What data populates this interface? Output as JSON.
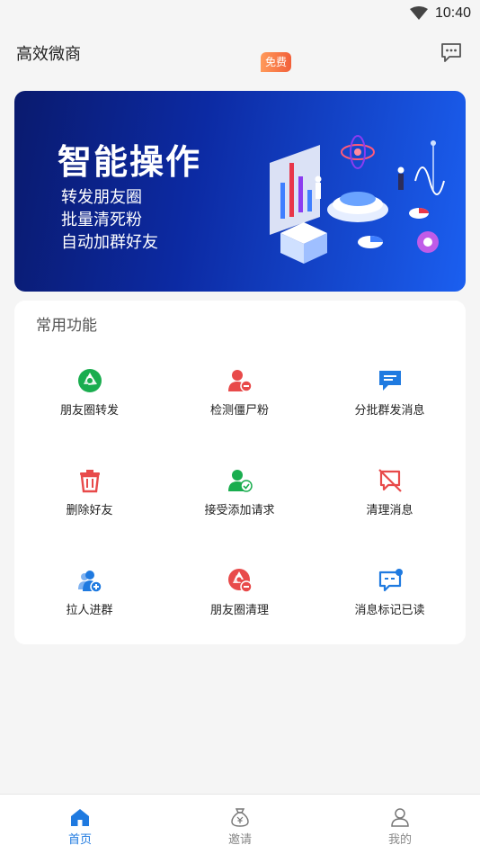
{
  "status_bar": {
    "time": "10:40"
  },
  "app_bar": {
    "title": "高效微商",
    "message_icon": "chat-bubble-icon"
  },
  "banner": {
    "title": "智能操作",
    "lines": [
      "转发朋友圈",
      "批量清死粉",
      "自动加群好友"
    ]
  },
  "functions": {
    "title": "常用功能",
    "badge": "免费",
    "items": [
      {
        "label": "朋友圈转发",
        "icon": "aperture-icon",
        "color": "#1aad4f"
      },
      {
        "label": "检测僵尸粉",
        "icon": "user-minus-icon",
        "color": "#e84a4a"
      },
      {
        "label": "分批群发消息",
        "icon": "message-square-icon",
        "color": "#1f7ae0"
      },
      {
        "label": "删除好友",
        "icon": "trash-icon",
        "color": "#e84a4a"
      },
      {
        "label": "接受添加请求",
        "icon": "user-check-icon",
        "color": "#1aad4f"
      },
      {
        "label": "清理消息",
        "icon": "message-off-icon",
        "color": "#e84a4a"
      },
      {
        "label": "拉人进群",
        "icon": "group-add-icon",
        "color": "#1f7ae0"
      },
      {
        "label": "朋友圈清理",
        "icon": "aperture-minus-icon",
        "color": "#e84a4a"
      },
      {
        "label": "消息标记已读",
        "icon": "message-read-icon",
        "color": "#1f7ae0"
      }
    ]
  },
  "bottom_nav": {
    "items": [
      {
        "label": "首页",
        "icon": "home-icon",
        "active": true
      },
      {
        "label": "邀请",
        "icon": "money-bag-icon",
        "active": false
      },
      {
        "label": "我的",
        "icon": "user-icon",
        "active": false
      }
    ]
  },
  "colors": {
    "accent": "#1f7ae0",
    "green": "#1aad4f",
    "red": "#e84a4a",
    "badge": "#f2603a"
  }
}
